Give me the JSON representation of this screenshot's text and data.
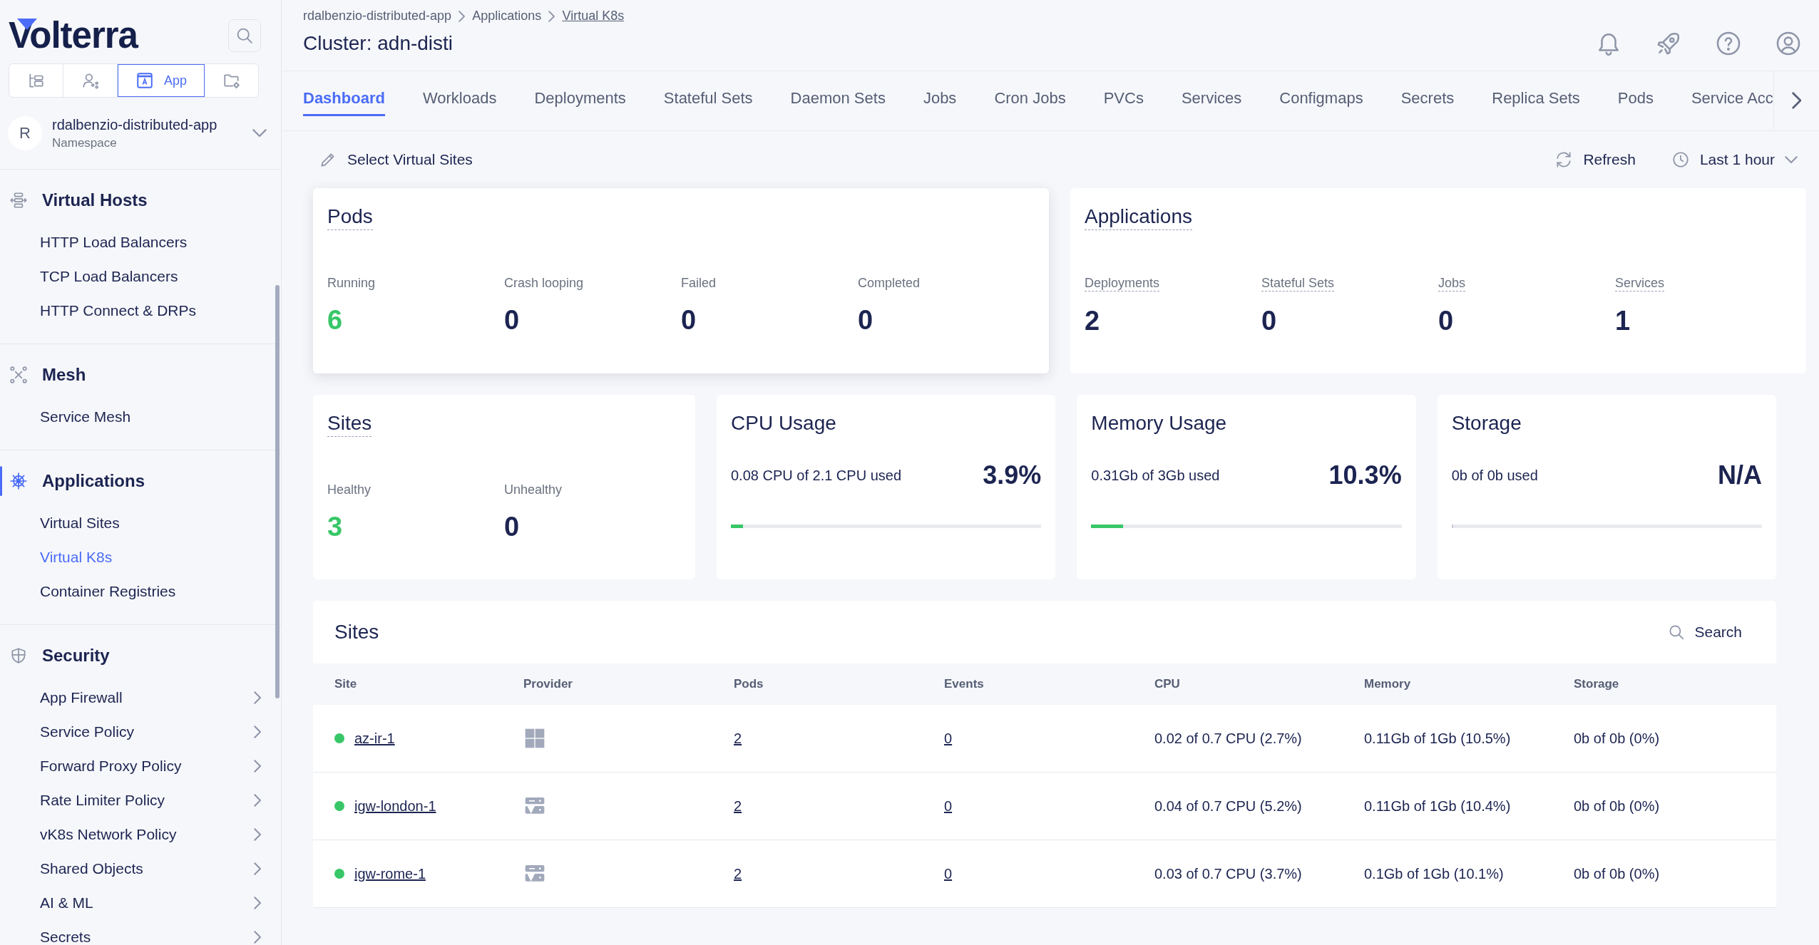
{
  "sidebar": {
    "logo": "Volterra",
    "modes": [
      {
        "selected": false
      },
      {
        "selected": false
      },
      {
        "label": "App",
        "selected": true
      },
      {
        "selected": false
      }
    ],
    "namespace": {
      "avatar": "R",
      "name": "rdalbenzio-distributed-app",
      "caption": "Namespace"
    },
    "sections": [
      {
        "title": "Virtual Hosts",
        "selected": false,
        "items": [
          {
            "label": "HTTP Load Balancers",
            "selected": false,
            "expandable": false
          },
          {
            "label": "TCP Load Balancers",
            "selected": false,
            "expandable": false
          },
          {
            "label": "HTTP Connect & DRPs",
            "selected": false,
            "expandable": false
          }
        ]
      },
      {
        "title": "Mesh",
        "selected": false,
        "items": [
          {
            "label": "Service Mesh",
            "selected": false,
            "expandable": false
          }
        ]
      },
      {
        "title": "Applications",
        "selected": true,
        "items": [
          {
            "label": "Virtual Sites",
            "selected": false,
            "expandable": false
          },
          {
            "label": "Virtual K8s",
            "selected": true,
            "expandable": false
          },
          {
            "label": "Container Registries",
            "selected": false,
            "expandable": false
          }
        ]
      },
      {
        "title": "Security",
        "selected": false,
        "items": [
          {
            "label": "App Firewall",
            "selected": false,
            "expandable": true
          },
          {
            "label": "Service Policy",
            "selected": false,
            "expandable": true
          },
          {
            "label": "Forward Proxy Policy",
            "selected": false,
            "expandable": true
          },
          {
            "label": "Rate Limiter Policy",
            "selected": false,
            "expandable": true
          },
          {
            "label": "vK8s Network Policy",
            "selected": false,
            "expandable": true
          },
          {
            "label": "Shared Objects",
            "selected": false,
            "expandable": true
          },
          {
            "label": "AI & ML",
            "selected": false,
            "expandable": true
          },
          {
            "label": "Secrets",
            "selected": false,
            "expandable": true
          }
        ]
      }
    ]
  },
  "header": {
    "breadcrumb": [
      "rdalbenzio-distributed-app",
      "Applications",
      "Virtual K8s"
    ],
    "title": "Cluster: adn-disti"
  },
  "tabs": [
    {
      "label": "Dashboard",
      "selected": true
    },
    {
      "label": "Workloads",
      "selected": false
    },
    {
      "label": "Deployments",
      "selected": false
    },
    {
      "label": "Stateful Sets",
      "selected": false
    },
    {
      "label": "Daemon Sets",
      "selected": false
    },
    {
      "label": "Jobs",
      "selected": false
    },
    {
      "label": "Cron Jobs",
      "selected": false
    },
    {
      "label": "PVCs",
      "selected": false
    },
    {
      "label": "Services",
      "selected": false
    },
    {
      "label": "Configmaps",
      "selected": false
    },
    {
      "label": "Secrets",
      "selected": false
    },
    {
      "label": "Replica Sets",
      "selected": false
    },
    {
      "label": "Pods",
      "selected": false
    },
    {
      "label": "Service Acc",
      "selected": false
    }
  ],
  "toolbar": {
    "select_sites": "Select Virtual Sites",
    "refresh": "Refresh",
    "time_range": "Last 1 hour"
  },
  "summary_cards": [
    {
      "title": "Pods",
      "links": false,
      "stats": [
        {
          "label": "Running",
          "value": "6",
          "color": "#38c768"
        },
        {
          "label": "Crash looping",
          "value": "0",
          "color": "#1c2451"
        },
        {
          "label": "Failed",
          "value": "0",
          "color": "#1c2451"
        },
        {
          "label": "Completed",
          "value": "0",
          "color": "#1c2451"
        }
      ]
    },
    {
      "title": "Applications",
      "links": true,
      "stats": [
        {
          "label": "Deployments",
          "value": "2",
          "color": "#1c2451"
        },
        {
          "label": "Stateful Sets",
          "value": "0",
          "color": "#1c2451"
        },
        {
          "label": "Jobs",
          "value": "0",
          "color": "#1c2451"
        },
        {
          "label": "Services",
          "value": "1",
          "color": "#1c2451"
        }
      ]
    }
  ],
  "sites_card": {
    "title": "Sites",
    "stats": [
      {
        "label": "Healthy",
        "value": "3",
        "color": "#38c768"
      },
      {
        "label": "Unhealthy",
        "value": "0",
        "color": "#1c2451"
      }
    ]
  },
  "usage_cards": [
    {
      "title": "CPU Usage",
      "used": "0.08 CPU of 2.1 CPU used",
      "percent": "3.9%",
      "level": 0.039
    },
    {
      "title": "Memory Usage",
      "used": "0.31Gb of 3Gb used",
      "percent": "10.3%",
      "level": 0.103
    },
    {
      "title": "Storage",
      "used": "0b of 0b used",
      "percent": "N/A",
      "level": 0
    }
  ],
  "sites_table": {
    "title": "Sites",
    "search": "Search",
    "columns": [
      "Site",
      "Provider",
      "Pods",
      "Events",
      "CPU",
      "Memory",
      "Storage"
    ],
    "rows": [
      {
        "color": "#38c768",
        "site": "az-ir-1",
        "kind": "cloud",
        "pods": "2",
        "events": "0",
        "cpu": "0.02 of 0.7 CPU (2.7%)",
        "memory": "0.11Gb of 1Gb (10.5%)",
        "storage": "0b of 0b (0%)"
      },
      {
        "color": "#38c768",
        "site": "igw-london-1",
        "kind": "gateway",
        "pods": "2",
        "events": "0",
        "cpu": "0.04 of 0.7 CPU (5.2%)",
        "memory": "0.11Gb of 1Gb (10.4%)",
        "storage": "0b of 0b (0%)"
      },
      {
        "color": "#38c768",
        "site": "igw-rome-1",
        "kind": "gateway",
        "pods": "2",
        "events": "0",
        "cpu": "0.03 of 0.7 CPU (3.7%)",
        "memory": "0.1Gb of 1Gb (10.1%)",
        "storage": "0b of 0b (0%)"
      }
    ]
  }
}
